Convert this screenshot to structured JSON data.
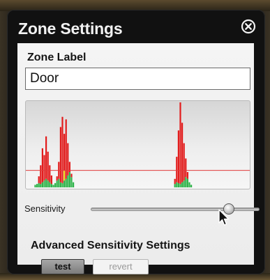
{
  "window": {
    "title": "Zone Settings"
  },
  "zone": {
    "label_heading": "Zone Label",
    "label_value": "Door"
  },
  "sensitivity": {
    "label": "Sensitivity",
    "level": 0.82
  },
  "advanced": {
    "heading": "Advanced Sensitivity Settings",
    "test_label": "test",
    "revert_label": "revert"
  },
  "icons": {
    "close": "close-circle-icon",
    "cursor": "mouse-pointer-icon"
  },
  "colors": {
    "activity_red": "#e21c1c",
    "activity_green": "#2fb34a",
    "activity_yellow": "#e6d31e",
    "threshold_line": "#e23a3a"
  },
  "chart_data": {
    "type": "bar",
    "y_range": [
      0,
      100
    ],
    "threshold": 20,
    "bars": [
      {
        "i": 4,
        "red": 0,
        "green": 3
      },
      {
        "i": 5,
        "red": 0,
        "green": 4
      },
      {
        "i": 6,
        "red": 8,
        "green": 5
      },
      {
        "i": 7,
        "red": 22,
        "green": 4
      },
      {
        "i": 8,
        "red": 40,
        "green": 6
      },
      {
        "i": 9,
        "red": 30,
        "green": 8
      },
      {
        "i": 10,
        "red": 50,
        "green": 10
      },
      {
        "i": 11,
        "red": 34,
        "green": 8
      },
      {
        "i": 12,
        "red": 20,
        "green": 6
      },
      {
        "i": 13,
        "red": 10,
        "green": 4
      },
      {
        "i": 14,
        "red": 0,
        "green": 3
      },
      {
        "i": 15,
        "red": 0,
        "green": 5
      },
      {
        "i": 16,
        "red": 5,
        "green": 8
      },
      {
        "i": 17,
        "red": 20,
        "green": 10
      },
      {
        "i": 18,
        "red": 65,
        "green": 6
      },
      {
        "i": 19,
        "red": 78,
        "green": 5
      },
      {
        "i": 20,
        "red": 55,
        "green": 8,
        "yellow": 12
      },
      {
        "i": 21,
        "red": 70,
        "green": 10
      },
      {
        "i": 22,
        "red": 38,
        "green": 14
      },
      {
        "i": 23,
        "red": 12,
        "green": 18
      },
      {
        "i": 24,
        "red": 4,
        "green": 12
      },
      {
        "i": 25,
        "red": 0,
        "green": 6
      },
      {
        "i": 81,
        "red": 6,
        "green": 4
      },
      {
        "i": 82,
        "red": 30,
        "green": 6
      },
      {
        "i": 83,
        "red": 62,
        "green": 5
      },
      {
        "i": 84,
        "red": 96,
        "green": 4
      },
      {
        "i": 85,
        "red": 70,
        "green": 6
      },
      {
        "i": 86,
        "red": 44,
        "green": 8
      },
      {
        "i": 87,
        "red": 22,
        "green": 12
      },
      {
        "i": 88,
        "red": 8,
        "green": 10
      },
      {
        "i": 89,
        "red": 0,
        "green": 6
      },
      {
        "i": 90,
        "red": 0,
        "green": 3
      }
    ]
  }
}
